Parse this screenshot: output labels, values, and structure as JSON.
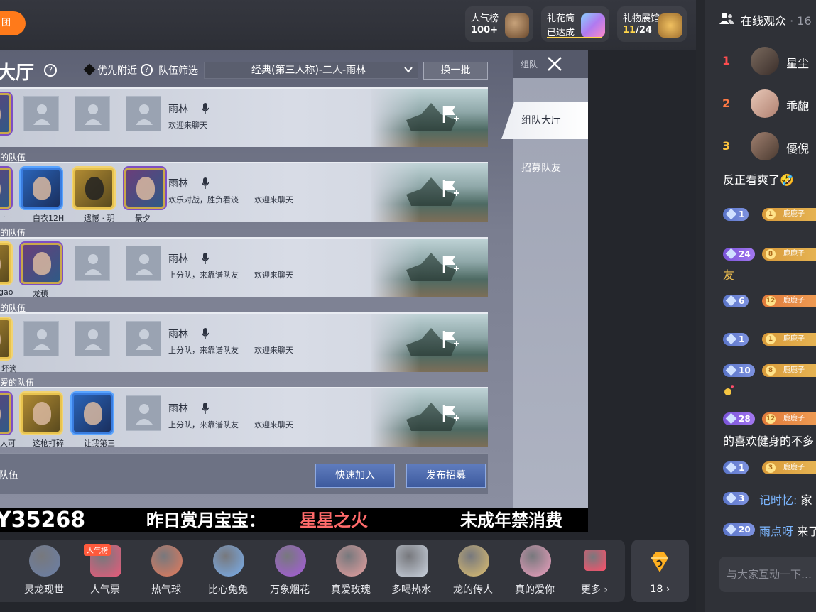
{
  "header": {
    "group_label": "团",
    "badges": [
      {
        "title": "人气榜",
        "value": "100+"
      },
      {
        "title": "礼花筒",
        "value": "已达成"
      },
      {
        "title": "礼物展馆",
        "value_current": "11",
        "value_total": "/24"
      }
    ]
  },
  "lobby": {
    "title": "大厅",
    "help_glyph": "?",
    "nearby_label": "优先附近",
    "filter_label": "队伍筛选",
    "filter_value": "经典(第三人称)-二人-雨林",
    "refresh_label": "换一批",
    "teams": [
      {
        "label": "",
        "map": "雨林",
        "tags": [
          "欢迎来聊天"
        ],
        "members": []
      },
      {
        "label": "的队伍",
        "map": "雨林",
        "tags": [
          "欢乐对战，胜负看淡",
          "欢迎来聊天"
        ],
        "members": [
          "·",
          "白衣12H",
          "遗憾 · 玥",
          "景夕"
        ]
      },
      {
        "label": "的队伍",
        "map": "雨林",
        "tags": [
          "上分队，来靠谱队友",
          "欢迎来聊天"
        ],
        "members": [
          "gao",
          "龙稹"
        ]
      },
      {
        "label": "的队伍",
        "map": "雨林",
        "tags": [
          "上分队，来靠谱队友",
          "欢迎来聊天"
        ],
        "members": [
          "坏滴"
        ]
      },
      {
        "label": "爱的队伍",
        "map": "雨林",
        "tags": [
          "上分队，来靠谱队友",
          "欢迎来聊天"
        ],
        "members": [
          "大可",
          "这枪打碎",
          "让我第三"
        ]
      }
    ],
    "bottom_label": "队伍",
    "quick_join_label": "快速加入",
    "publish_label": "发布招募"
  },
  "side": {
    "header_label": "组队",
    "tab_active": "组队大厅",
    "tab_other": "招募队友"
  },
  "ticker": {
    "code": "Y35268",
    "label": "昨日赏月宝宝：",
    "star": "星星之火",
    "minor": "未成年禁消费"
  },
  "gifts": [
    {
      "name": "灵龙现世",
      "color": "#6a7fa8"
    },
    {
      "name": "人气票",
      "color": "#e85a7a",
      "badge": "人气榜"
    },
    {
      "name": "热气球",
      "color": "#e87a5a"
    },
    {
      "name": "比心兔兔",
      "color": "#7ab0f0"
    },
    {
      "name": "万象烟花",
      "color": "#a85ae0"
    },
    {
      "name": "真爱玫瑰",
      "color": "#e8a0a0"
    },
    {
      "name": "多喝热水",
      "color": "#c8d0dc"
    },
    {
      "name": "龙的传人",
      "color": "#e0c070"
    },
    {
      "name": "真的爱你",
      "color": "#f0a0c0"
    },
    {
      "name": "更多",
      "color": "#ff4f6a"
    }
  ],
  "diamond": {
    "count": "18"
  },
  "audience": {
    "title": "在线观众",
    "count": "· 16",
    "top": [
      {
        "rank": "1",
        "name": "星尘",
        "color": "#ff4d4f"
      },
      {
        "rank": "2",
        "name": "乖龅",
        "color": "#ff7a45"
      },
      {
        "rank": "3",
        "name": "優倪",
        "color": "#ffc53d"
      }
    ]
  },
  "chat": {
    "line1": "反正看爽了🤣",
    "messages": [
      {
        "level": "1",
        "fan_level": "1",
        "fan_name": "鹿鹿子"
      },
      {
        "level": "24",
        "fan_level": "8",
        "fan_name": "鹿鹿子",
        "text": "友"
      },
      {
        "level": "6",
        "fan_level": "12",
        "fan_name": "鹿鹿子"
      },
      {
        "level": "1",
        "fan_level": "1",
        "fan_name": "鹿鹿子"
      },
      {
        "level": "10",
        "fan_level": "8",
        "fan_name": "鹿鹿子"
      },
      {
        "level": "28",
        "fan_level": "12",
        "fan_name": "鹿鹿子",
        "text": "的喜欢健身的不多"
      },
      {
        "level": "1",
        "fan_level": "3",
        "fan_name": "鹿鹿子"
      },
      {
        "level": "3",
        "user": "记时忆:",
        "text": "家"
      },
      {
        "level": "20",
        "user": "雨点呀",
        "text": "来了"
      }
    ],
    "input_placeholder": "与大家互动一下…"
  }
}
